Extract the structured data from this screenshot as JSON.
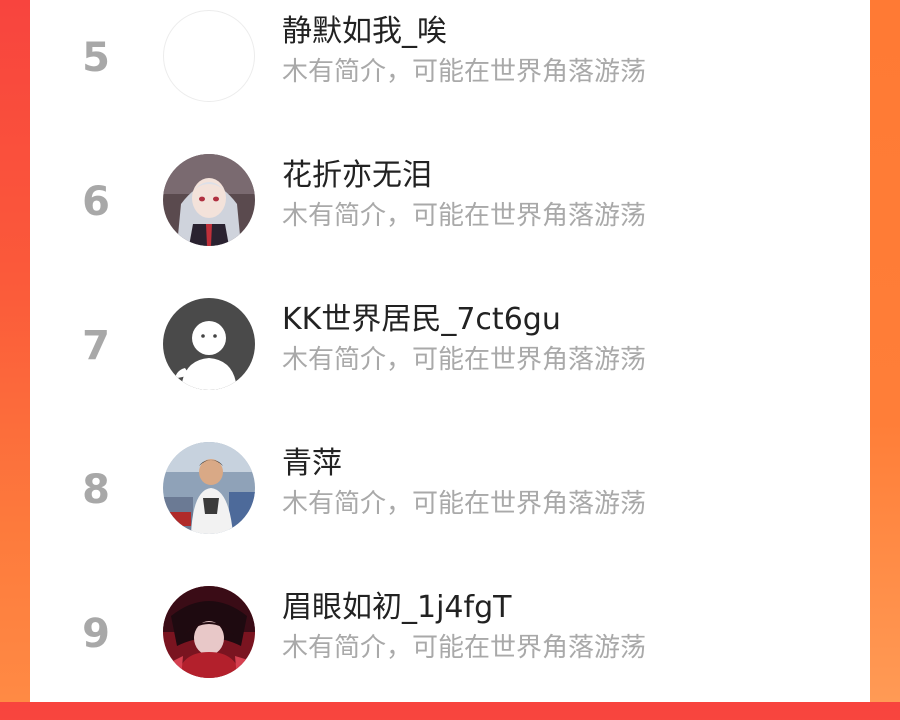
{
  "leaderboard": {
    "entries": [
      {
        "rank": "5",
        "name": "静默如我_唉",
        "bio": "木有简介，可能在世界角落游荡",
        "avatar": "blank-avatar"
      },
      {
        "rank": "6",
        "name": "花折亦无泪",
        "bio": "木有简介，可能在世界角落游荡",
        "avatar": "anime-girl-avatar"
      },
      {
        "rank": "7",
        "name": "KK世界居民_7ct6gu",
        "bio": "木有简介，可能在世界角落游荡",
        "avatar": "default-person-avatar"
      },
      {
        "rank": "8",
        "name": "青萍",
        "bio": "木有简介，可能在世界角落游荡",
        "avatar": "photo-man-avatar"
      },
      {
        "rank": "9",
        "name": "眉眼如初_1j4fgT",
        "bio": "木有简介，可能在世界角落游荡",
        "avatar": "anime-red-avatar"
      }
    ]
  },
  "colors": {
    "background_left": "#f8443e",
    "background_right": "#ff7e38",
    "rank_text": "#a8a8a8",
    "name_text": "#222222",
    "bio_text": "#a9a9a9",
    "panel": "#ffffff"
  }
}
